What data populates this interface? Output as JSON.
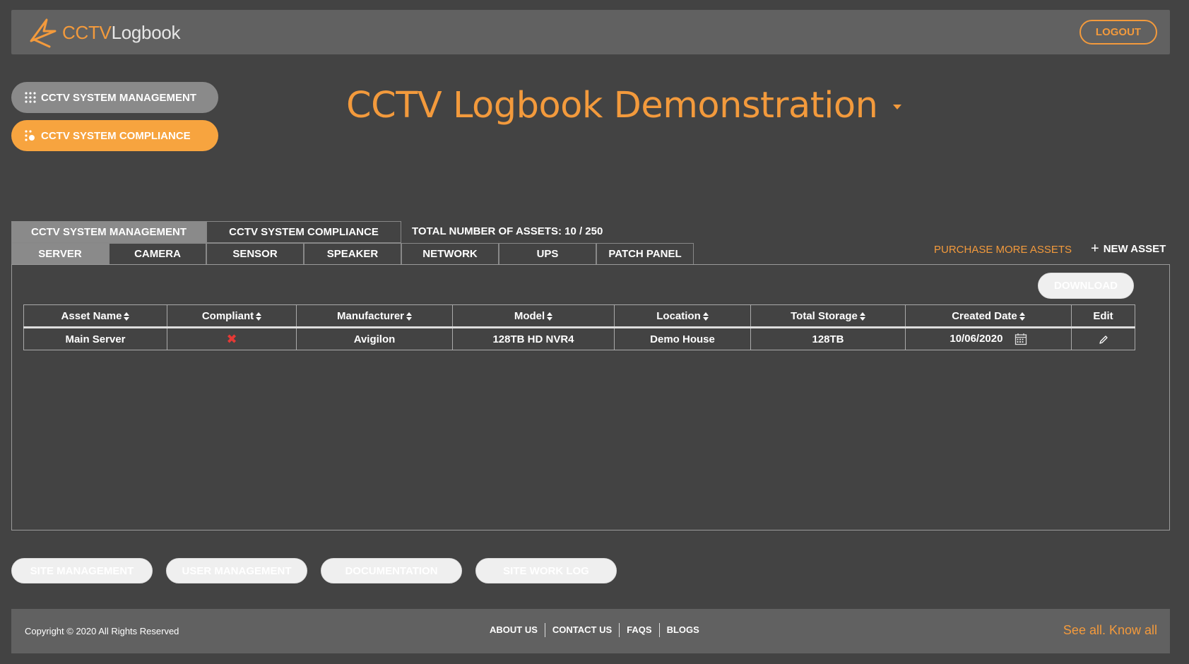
{
  "header": {
    "logo_part1": "CCTV",
    "logo_part2": "Logbook",
    "logout_label": "LOGOUT"
  },
  "nav": {
    "management_label": "CCTV SYSTEM MANAGEMENT",
    "compliance_label": "CCTV SYSTEM COMPLIANCE"
  },
  "page_title": "CCTV Logbook Demonstration",
  "tabs_top": [
    {
      "label": "CCTV SYSTEM MANAGEMENT",
      "active": true
    },
    {
      "label": "CCTV SYSTEM COMPLIANCE",
      "active": false
    }
  ],
  "assets_total": "TOTAL NUMBER OF ASSETS: 10 / 250",
  "tabs_types": [
    {
      "label": "SERVER",
      "active": true
    },
    {
      "label": "CAMERA",
      "active": false
    },
    {
      "label": "SENSOR",
      "active": false
    },
    {
      "label": "SPEAKER",
      "active": false
    },
    {
      "label": "NETWORK",
      "active": false
    },
    {
      "label": "UPS",
      "active": false
    },
    {
      "label": "PATCH PANEL",
      "active": false
    }
  ],
  "actions": {
    "purchase_label": "PURCHASE MORE ASSETS",
    "new_asset_label": "NEW ASSET",
    "download_label": "DOWNLOAD"
  },
  "table": {
    "headers": [
      "Asset Name",
      "Compliant",
      "Manufacturer",
      "Model",
      "Location",
      "Total Storage",
      "Created Date",
      "Edit"
    ],
    "rows": [
      {
        "asset_name": "Main Server",
        "compliant_icon": "x-mark-icon",
        "manufacturer": "Avigilon",
        "model": "128TB HD NVR4",
        "location": "Demo House",
        "total_storage": "128TB",
        "created_date": "10/06/2020"
      }
    ]
  },
  "bottom_buttons": [
    "SITE MANAGEMENT",
    "USER MANAGEMENT",
    "DOCUMENTATION",
    "SITE WORK LOG"
  ],
  "footer": {
    "copyright": "Copyright © 2020 All Rights Reserved",
    "links": [
      "ABOUT US",
      "CONTACT US",
      "FAQS",
      "BLOGS"
    ],
    "tagline": "See all. Know all"
  },
  "colors": {
    "accent": "#f39a3c",
    "background": "#434343",
    "bar": "#616161",
    "error": "#e53935"
  }
}
